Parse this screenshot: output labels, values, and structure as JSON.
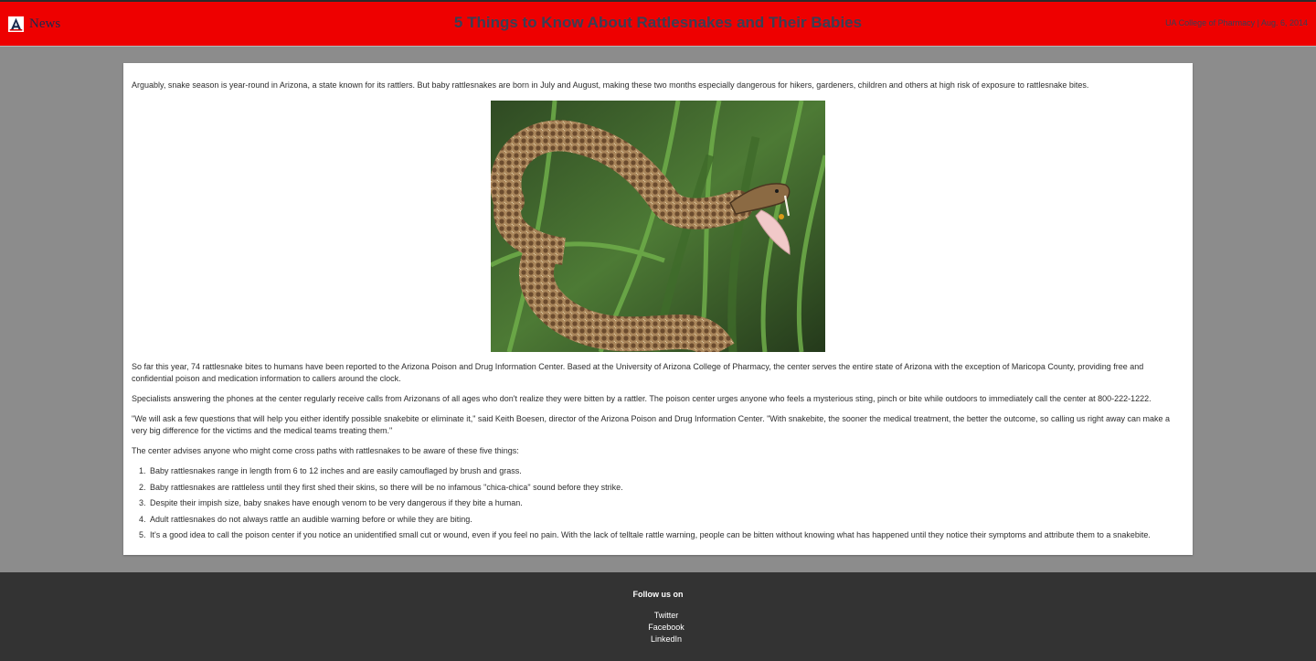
{
  "header": {
    "brand_label": "News",
    "title": "5 Things to Know About Rattlesnakes and Their Babies",
    "meta": "UA College of Pharmacy | Aug. 6, 2014",
    "colors": {
      "banner": "#ee0000",
      "title_text": "#3a3f55",
      "brand_text": "#1b2a4e"
    }
  },
  "article": {
    "intro": "Arguably, snake season is year-round in Arizona, a state known for its rattlers. But baby rattlesnakes are born in July and August, making these two months especially dangerous for hikers, gardeners, children and others at high risk of exposure to rattlesnake bites.",
    "paragraphs": [
      "So far this year, 74 rattlesnake bites to humans have been reported to the Arizona Poison and Drug Information Center. Based at the University of Arizona College of Pharmacy, the center serves the entire state of Arizona with the exception of Maricopa County, providing free and confidential poison and medication information to callers around the clock.",
      "Specialists answering the phones at the center regularly receive calls from Arizonans of all ages who don't realize they were bitten by a rattler. The poison center urges anyone who feels a mysterious sting, pinch or bite while outdoors to immediately call the center at 800-222-1222.",
      "\"We will ask a few questions that will help you either identify possible snakebite or eliminate it,\" said Keith Boesen, director of the Arizona Poison and Drug Information Center. \"With snakebite, the sooner the medical treatment, the better the outcome, so calling us right away can make a very big difference for the victims and the medical teams treating them.\"",
      "The center advises anyone who might come cross paths with rattlesnakes to be aware of these five things:"
    ],
    "list": [
      "Baby rattlesnakes range in length from 6 to 12 inches and are easily camouflaged by brush and grass.",
      "Baby rattlesnakes are rattleless until they first shed their skins, so there will be no infamous \"chica-chica\" sound before they strike.",
      "Despite their impish size, baby snakes have enough venom to be very dangerous if they bite a human.",
      "Adult rattlesnakes do not always rattle an audible warning before or while they are biting.",
      "It's a good idea to call the poison center if you notice an unidentified small cut or wound, even if you feel no pain. With the lack of telltale rattle warning, people can be bitten without knowing what has happened until they notice their symptoms and attribute them to a snakebite."
    ]
  },
  "footer": {
    "follow_label": "Follow us on",
    "links": [
      "Twitter",
      "Facebook",
      "LinkedIn"
    ]
  },
  "icons": {
    "brand": "university-a-logo-icon",
    "photo": "rattlesnake-photo"
  }
}
